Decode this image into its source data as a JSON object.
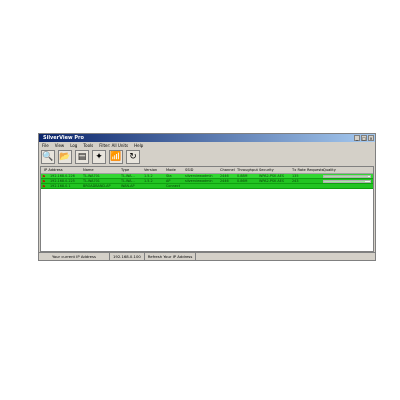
{
  "window": {
    "title": "SilverView Pro"
  },
  "menus": [
    "File",
    "View",
    "Log",
    "Tools",
    "Filter: All Units",
    "Help"
  ],
  "toolbar": [
    {
      "name": "scan-icon",
      "glyph": "🔍"
    },
    {
      "name": "folder-icon",
      "glyph": "📂"
    },
    {
      "name": "config-icon",
      "glyph": "▤"
    },
    {
      "name": "wizard-icon",
      "glyph": "✦"
    },
    {
      "name": "signal-icon",
      "glyph": "📶"
    },
    {
      "name": "refresh-icon",
      "glyph": "↻"
    }
  ],
  "columns": [
    "IP Address",
    "Name",
    "Type",
    "Version",
    "Mode",
    "SSID",
    "Channel",
    "Throughput",
    "Security",
    "Tx Rate",
    "Requests",
    "Quality"
  ],
  "rows": [
    {
      "status": "⚑",
      "ip": "192.168.0.226",
      "name": "TL-WA701",
      "type": "TL-WA...",
      "version": "1.5.2",
      "mode": "Sta",
      "ssid": "silverviewadmin",
      "channel": "2446",
      "throughput": "0.88M",
      "security": "WPA2-PSK AES",
      "txrate": "135",
      "requests": "",
      "quality": 0.95
    },
    {
      "status": "⚑",
      "ip": "192.168.0.225",
      "name": "TL-WA701",
      "type": "TL-WA...",
      "version": "1.5.2",
      "mode": "AP",
      "ssid": "silverviewadmin",
      "channel": "2446",
      "throughput": "0.86M",
      "security": "WPA2-PSK AES",
      "txrate": "243",
      "requests": "",
      "quality": 0.9
    },
    {
      "status": "⚑",
      "ip": "192.168.0.1",
      "name": "BROADBAND-AP",
      "type": "WAN-AP",
      "version": "",
      "mode": "Connect",
      "ssid": "",
      "channel": "",
      "throughput": "",
      "security": "",
      "txrate": "",
      "requests": "",
      "quality": 0
    }
  ],
  "statusbar": {
    "label": "Your current IP Address",
    "ip": "192.168.0.100",
    "refresh": "Refresh Your IP Address"
  }
}
